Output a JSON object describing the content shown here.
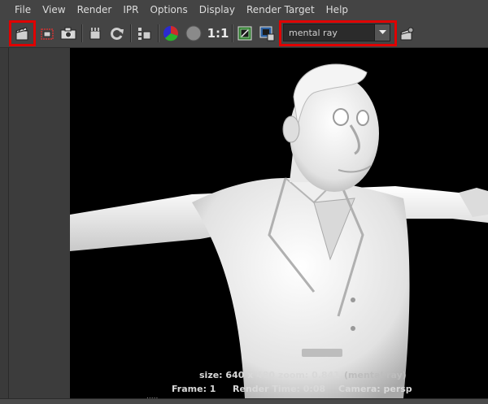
{
  "menu": [
    "File",
    "View",
    "Render",
    "IPR",
    "Options",
    "Display",
    "Render Target",
    "Help"
  ],
  "toolbar": {
    "icons": [
      {
        "name": "redo-previous-render-icon"
      },
      {
        "name": "render-region-icon"
      },
      {
        "name": "snapshot-icon"
      },
      {
        "name": "ipr-render-icon"
      },
      {
        "name": "refresh-icon"
      },
      {
        "name": "ipr-tuning-icon"
      },
      {
        "name": "rgb-channels-icon"
      },
      {
        "name": "alpha-channel-icon"
      },
      {
        "name": "keep-image-icon"
      },
      {
        "name": "remove-image-icon"
      },
      {
        "name": "render-settings-icon"
      }
    ],
    "real_size_label": "1:1",
    "renderer_value": "mental ray",
    "highlight_color": "#e00000"
  },
  "render_info": {
    "size": "size: 640 x 480 zoom: 0.841",
    "renderer": "(mental ray)",
    "frame": "Frame: 1",
    "render_time": "Render Time: 0:08",
    "camera": "Camera: persp"
  },
  "bottom_handle": "....."
}
